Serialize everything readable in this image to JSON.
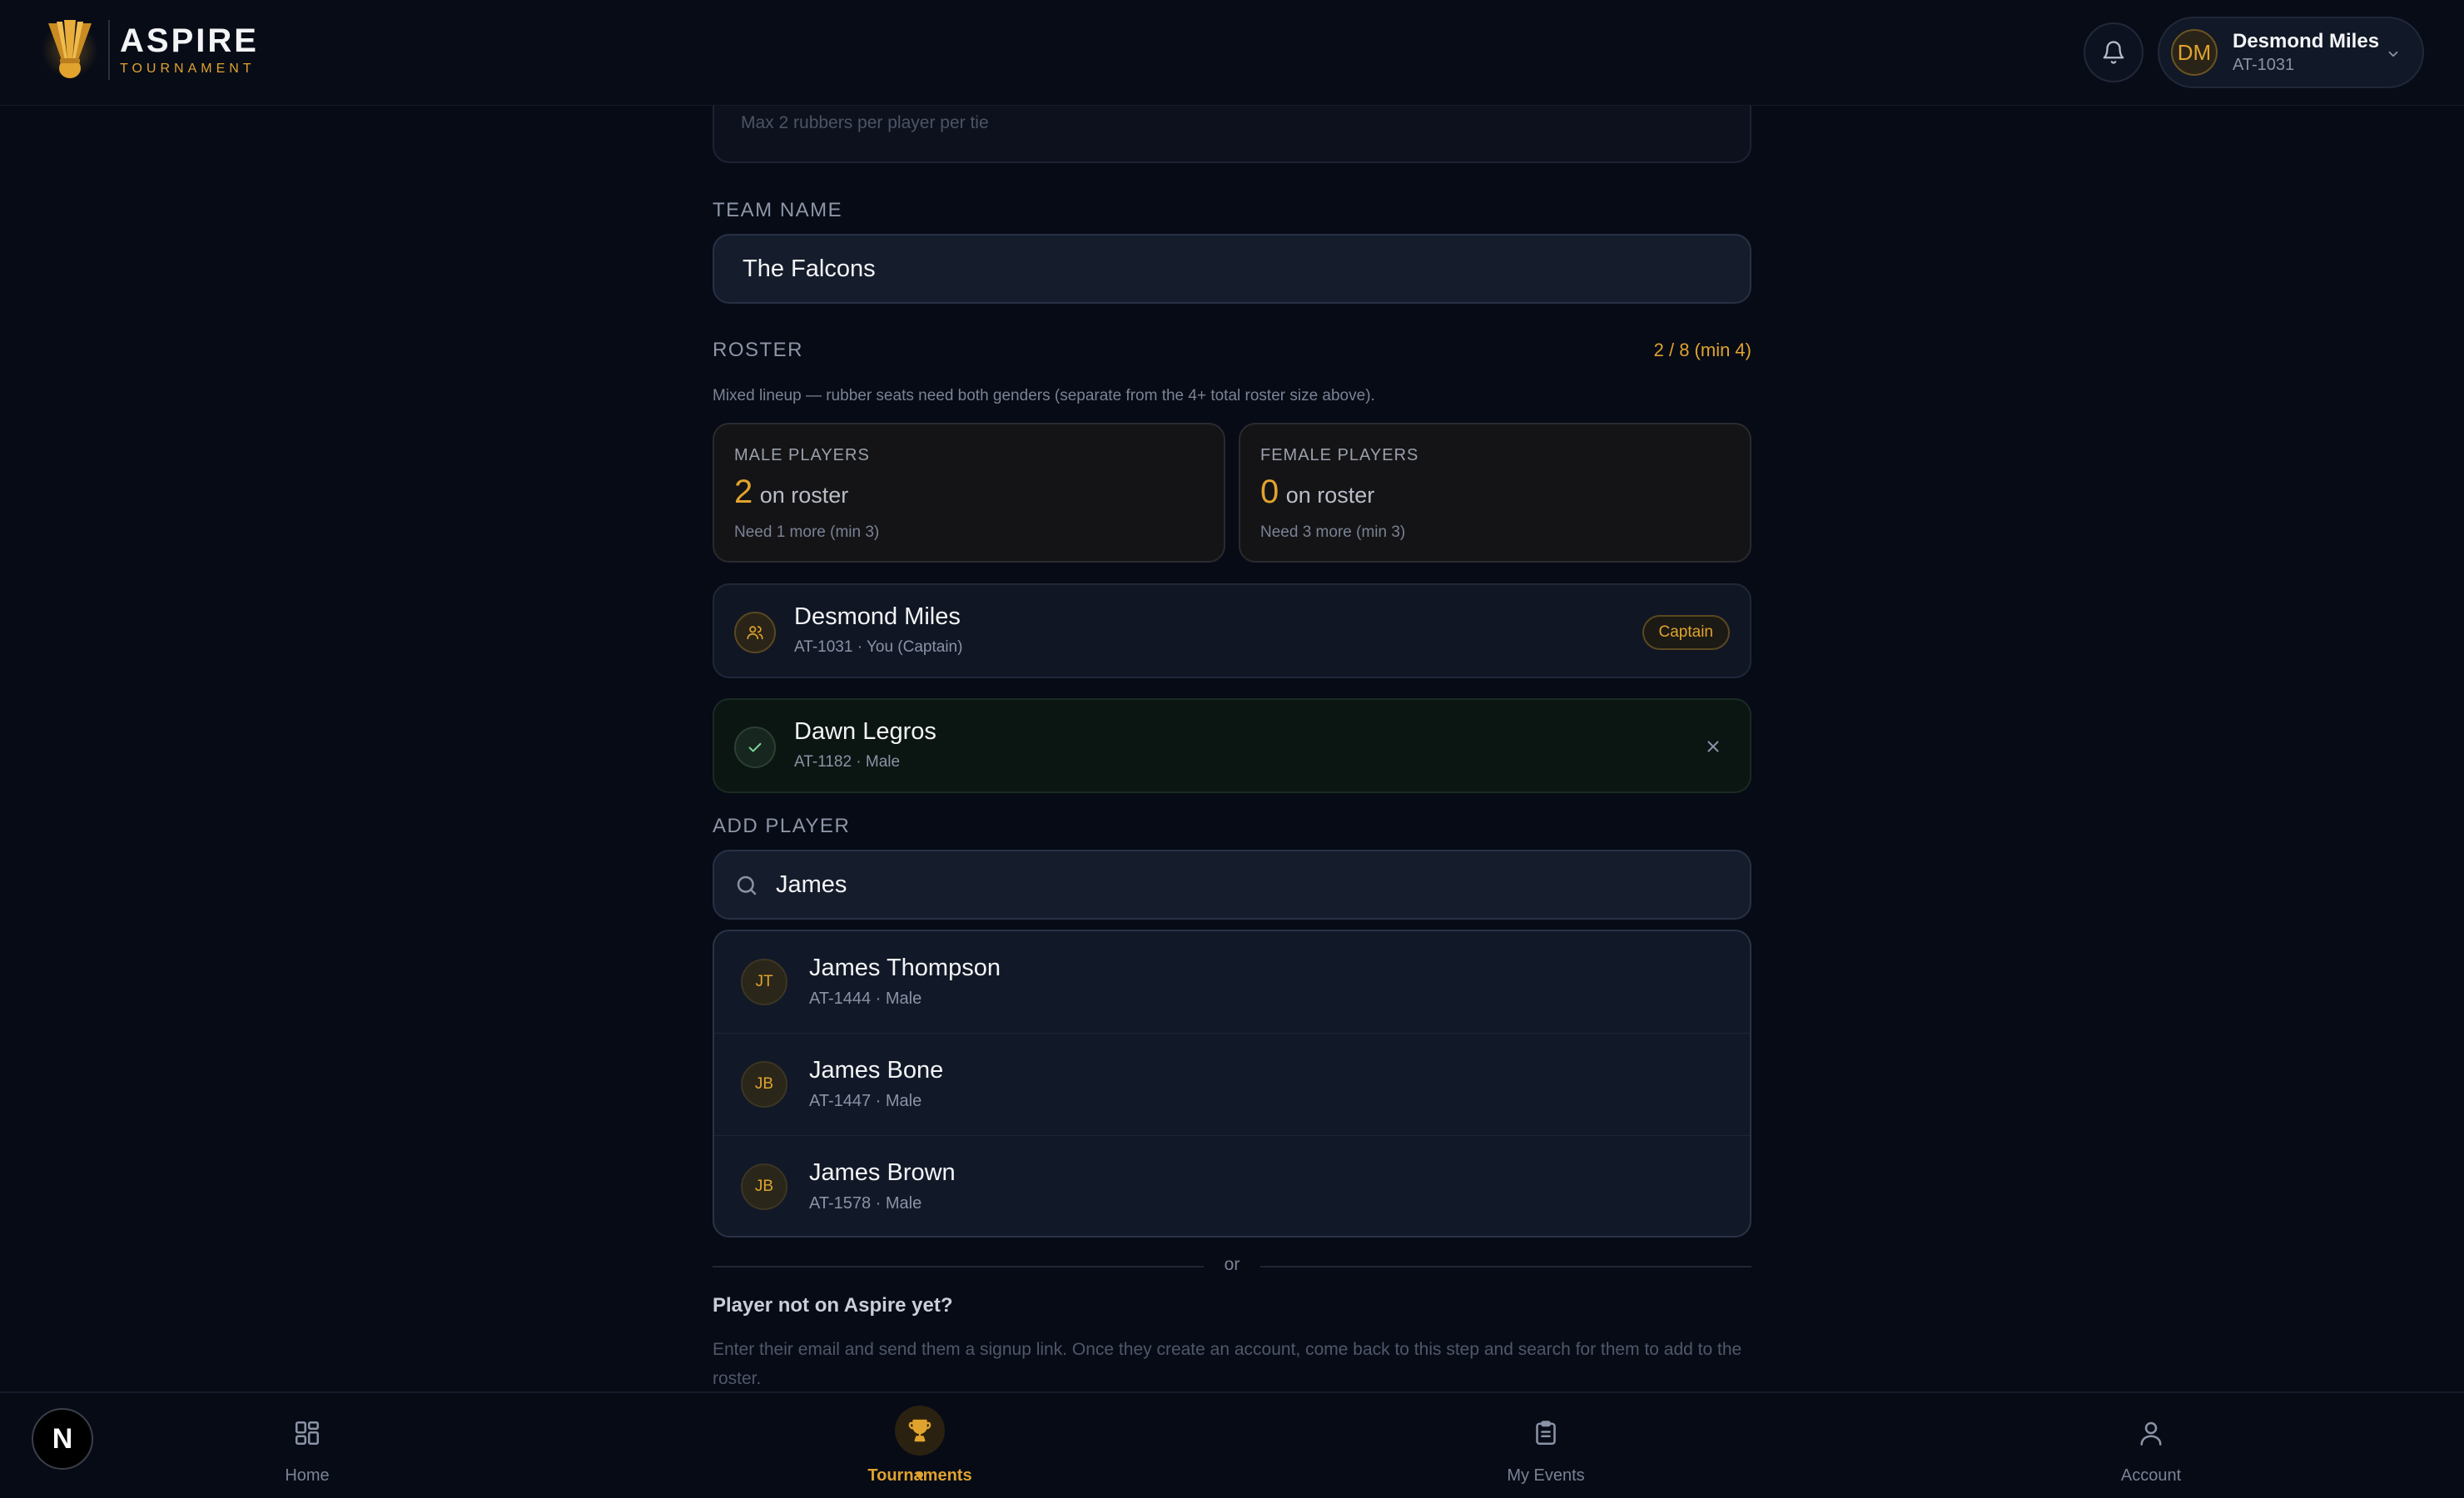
{
  "brand": {
    "name": "ASPIRE",
    "sub": "TOURNAMENT"
  },
  "user": {
    "initials": "DM",
    "name": "Desmond Miles",
    "id": "AT-1031"
  },
  "form": {
    "top_hint": "Max 2 rubbers per player per tie",
    "team_name_label": "TEAM NAME",
    "team_name_value": "The Falcons",
    "roster_label": "ROSTER",
    "roster_count": "2 / 8 (min 4)",
    "roster_note": "Mixed lineup — rubber seats need both genders (separate from the 4+ total roster size above).",
    "male": {
      "title": "MALE PLAYERS",
      "count": "2",
      "suffix": "on roster",
      "need": "Need 1 more (min 3)"
    },
    "female": {
      "title": "FEMALE PLAYERS",
      "count": "0",
      "suffix": "on roster",
      "need": "Need 3 more (min 3)"
    },
    "roster": [
      {
        "name": "Desmond Miles",
        "meta": "AT-1031 · You (Captain)",
        "badge": "Captain"
      },
      {
        "name": "Dawn Legros",
        "meta": "AT-1182 · Male"
      }
    ],
    "add_player_label": "ADD PLAYER",
    "search_value": "James",
    "results": [
      {
        "initials": "JT",
        "name": "James Thompson",
        "meta": "AT-1444 · Male"
      },
      {
        "initials": "JB",
        "name": "James Bone",
        "meta": "AT-1447 · Male"
      },
      {
        "initials": "JB",
        "name": "James Brown",
        "meta": "AT-1578 · Male"
      }
    ],
    "or_text": "or",
    "not_on_title": "Player not on Aspire yet?",
    "not_on_desc": "Enter their email and send them a signup link. Once they create an account, come back to this step and search for them to add to the roster."
  },
  "nav": {
    "badge": "N",
    "items": [
      {
        "label": "Home",
        "icon": "grid-icon"
      },
      {
        "label": "Tournaments",
        "icon": "trophy-icon"
      },
      {
        "label": "My Events",
        "icon": "clipboard-icon"
      },
      {
        "label": "Account",
        "icon": "person-icon"
      }
    ]
  },
  "colors": {
    "accent": "#e0a32e",
    "background": "#070b16",
    "card": "#111827"
  }
}
